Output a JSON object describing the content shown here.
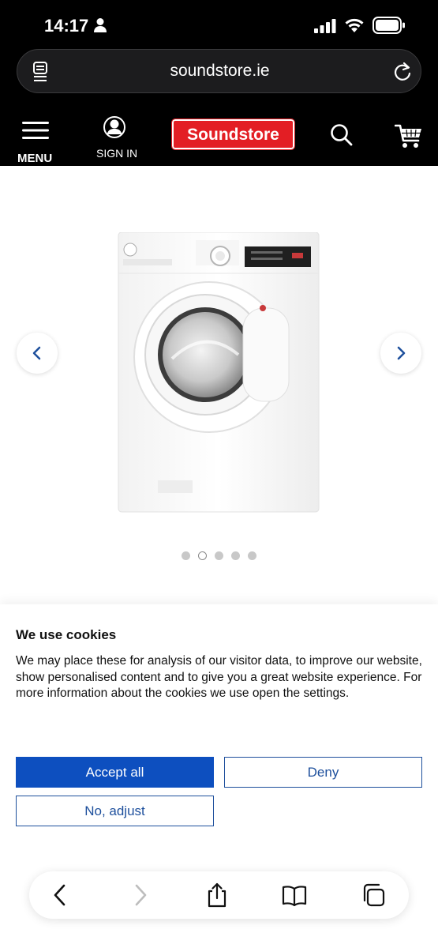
{
  "status_bar": {
    "time": "14:17",
    "icons": [
      "person-icon",
      "signal-icon",
      "wifi-icon",
      "battery-icon"
    ]
  },
  "browser": {
    "url": "soundstore.ie",
    "icons": [
      "reader-icon",
      "reload-icon"
    ]
  },
  "site_nav": {
    "menu_label": "MENU",
    "signin_label": "SIGN IN",
    "logo_text": "Soundstore",
    "icons": [
      "menu-icon",
      "user-icon",
      "search-icon",
      "cart-icon"
    ]
  },
  "gallery": {
    "image": "washing-machine",
    "slide_count": 5,
    "active_slide": 2
  },
  "cookie_banner": {
    "title": "We use cookies",
    "text": "We may place these for analysis of our visitor data, to improve our website, show personalised content and to give you a great website experience. For more information about the cookies we use open the settings.",
    "accept_label": "Accept all",
    "deny_label": "Deny",
    "adjust_label": "No, adjust"
  },
  "browser_toolbar": {
    "icons": [
      "back-icon",
      "forward-icon",
      "share-icon",
      "bookmarks-icon",
      "tabs-icon"
    ]
  },
  "colors": {
    "brand_red": "#e31e24",
    "accent_blue": "#0d4fbf",
    "outline_blue": "#1d4f9c"
  }
}
